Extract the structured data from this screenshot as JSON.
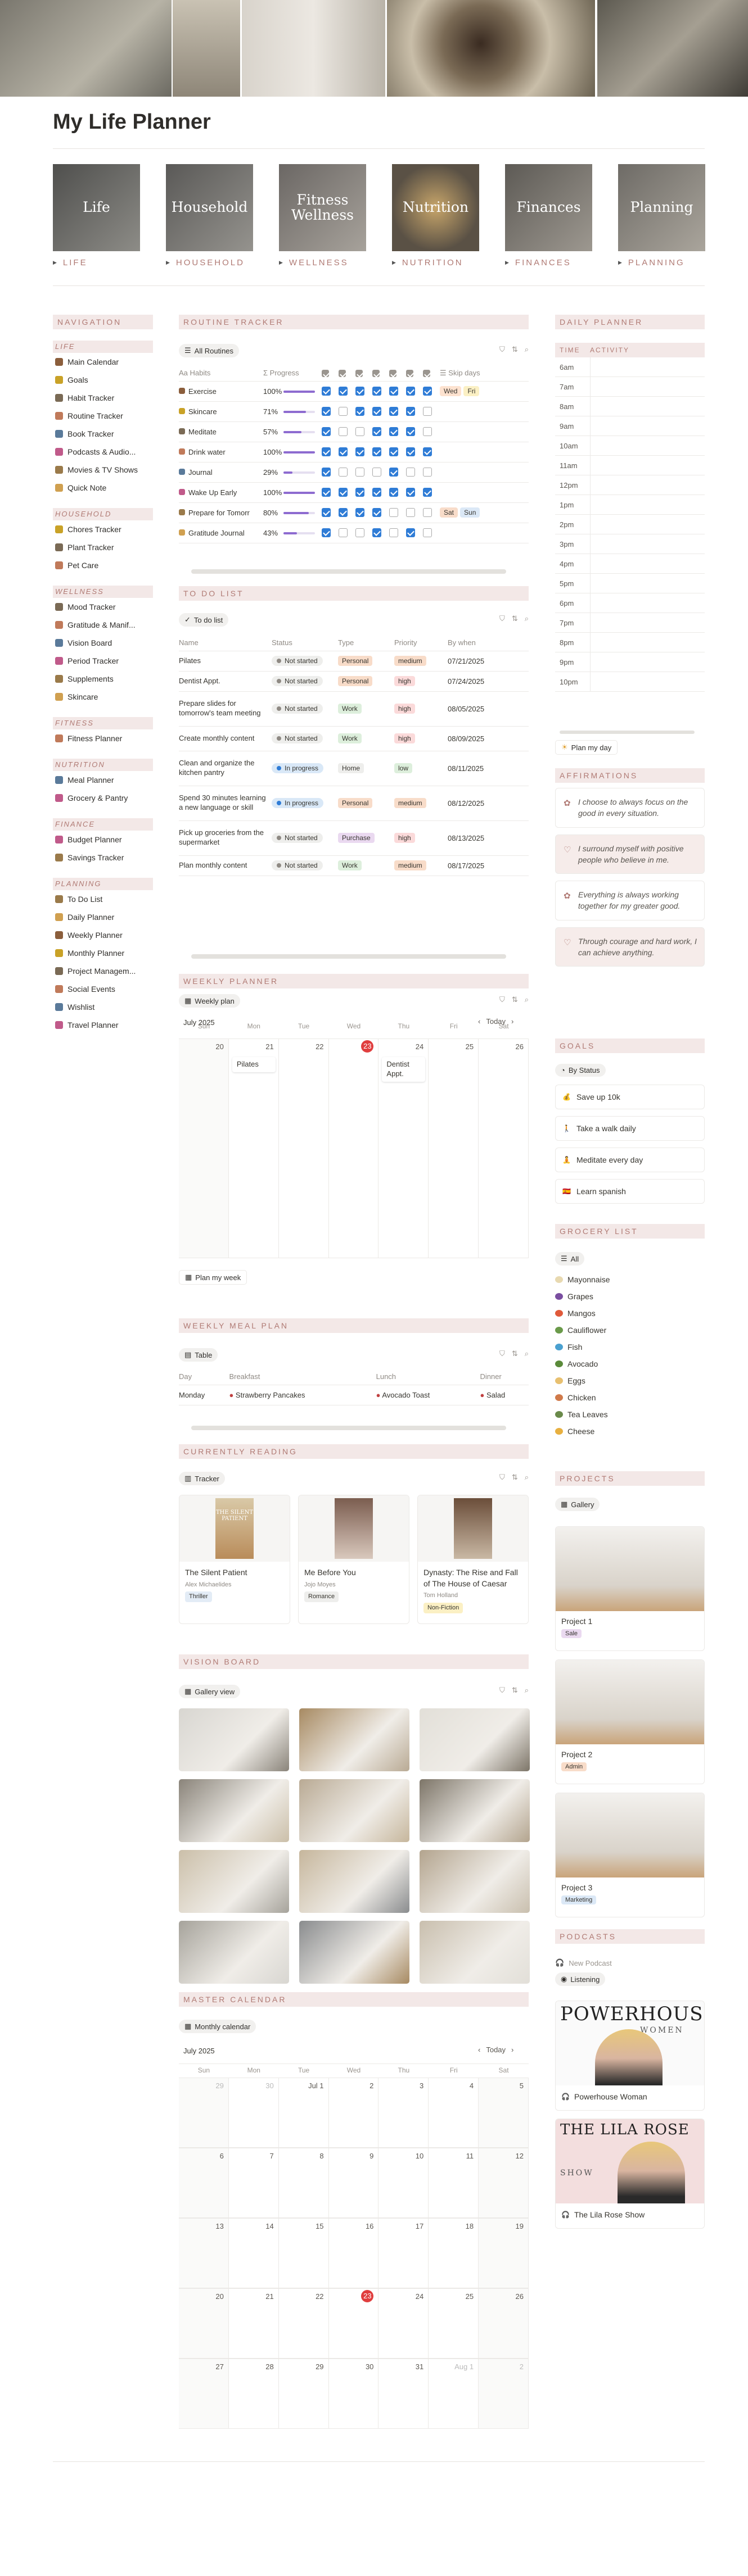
{
  "page_title": "My Life Planner",
  "categories": [
    {
      "img": "Life",
      "label": "LIFE"
    },
    {
      "img": "Household",
      "label": "HOUSEHOLD"
    },
    {
      "img": "Fitness Wellness",
      "label": "WELLNESS"
    },
    {
      "img": "Nutrition",
      "label": "NUTRITION"
    },
    {
      "img": "Finances",
      "label": "FINANCES"
    },
    {
      "img": "Planning",
      "label": "PLANNING"
    }
  ],
  "navigation": {
    "title": "NAVIGATION",
    "groups": [
      {
        "name": "LIFE",
        "items": [
          "Main Calendar",
          "Goals",
          "Habit Tracker",
          "Routine Tracker",
          "Book Tracker",
          "Podcasts & Audio...",
          "Movies & TV Shows",
          "Quick Note"
        ]
      },
      {
        "name": "HOUSEHOLD",
        "items": [
          "Chores Tracker",
          "Plant Tracker",
          "Pet Care"
        ]
      },
      {
        "name": "WELLNESS",
        "items": [
          "Mood Tracker",
          "Gratitude & Manif...",
          "Vision Board",
          "Period Tracker",
          "Supplements",
          "Skincare"
        ]
      },
      {
        "name": "FITNESS",
        "items": [
          "Fitness Planner"
        ]
      },
      {
        "name": "NUTRITION",
        "items": [
          "Meal Planner",
          "Grocery & Pantry"
        ]
      },
      {
        "name": "FINANCE",
        "items": [
          "Budget Planner",
          "Savings Tracker"
        ]
      },
      {
        "name": "PLANNING",
        "items": [
          "To Do List",
          "Daily Planner",
          "Weekly Planner",
          "Monthly Planner",
          "Project Managem...",
          "Social Events",
          "Wishlist",
          "Travel Planner"
        ]
      }
    ]
  },
  "routine": {
    "title": "ROUTINE TRACKER",
    "view": "All Routines",
    "cols": {
      "habits": "Habits",
      "progress": "Progress",
      "skip": "Skip days"
    },
    "rows": [
      {
        "name": "Exercise",
        "pct": "100%",
        "p": 1.0,
        "checks": [
          1,
          1,
          1,
          1,
          1,
          1,
          1
        ],
        "skip": [
          "Wed",
          "Fri"
        ]
      },
      {
        "name": "Skincare",
        "pct": "71%",
        "p": 0.71,
        "checks": [
          1,
          0,
          1,
          1,
          1,
          1,
          0
        ],
        "skip": []
      },
      {
        "name": "Meditate",
        "pct": "57%",
        "p": 0.57,
        "checks": [
          1,
          0,
          0,
          1,
          1,
          1,
          0
        ],
        "skip": []
      },
      {
        "name": "Drink water",
        "pct": "100%",
        "p": 1.0,
        "checks": [
          1,
          1,
          1,
          1,
          1,
          1,
          1
        ],
        "skip": []
      },
      {
        "name": "Journal",
        "pct": "29%",
        "p": 0.29,
        "checks": [
          1,
          0,
          0,
          0,
          1,
          0,
          0
        ],
        "skip": []
      },
      {
        "name": "Wake Up Early",
        "pct": "100%",
        "p": 1.0,
        "checks": [
          1,
          1,
          1,
          1,
          1,
          1,
          1
        ],
        "skip": []
      },
      {
        "name": "Prepare for Tomorr",
        "pct": "80%",
        "p": 0.8,
        "checks": [
          1,
          1,
          1,
          1,
          0,
          0,
          0
        ],
        "skip": [
          "Sat",
          "Sun"
        ]
      },
      {
        "name": "Gratitude Journal",
        "pct": "43%",
        "p": 0.43,
        "checks": [
          1,
          0,
          0,
          1,
          0,
          1,
          0
        ],
        "skip": []
      }
    ]
  },
  "todo": {
    "title": "TO DO LIST",
    "view": "To do list",
    "cols": [
      "Name",
      "Status",
      "Type",
      "Priority",
      "By when"
    ],
    "rows": [
      {
        "name": "Pilates",
        "status": "Not started",
        "type": "Personal",
        "priority": "medium",
        "date": "07/21/2025"
      },
      {
        "name": "Dentist Appt.",
        "status": "Not started",
        "type": "Personal",
        "priority": "high",
        "date": "07/24/2025"
      },
      {
        "name": "Prepare slides for tomorrow's team meeting",
        "status": "Not started",
        "type": "Work",
        "priority": "high",
        "date": "08/05/2025"
      },
      {
        "name": "Create monthly content",
        "status": "Not started",
        "type": "Work",
        "priority": "high",
        "date": "08/09/2025"
      },
      {
        "name": "Clean and organize the kitchen pantry",
        "status": "In progress",
        "type": "Home",
        "priority": "low",
        "date": "08/11/2025"
      },
      {
        "name": "Spend 30 minutes learning a new language or skill",
        "status": "In progress",
        "type": "Personal",
        "priority": "medium",
        "date": "08/12/2025"
      },
      {
        "name": "Pick up groceries from the supermarket",
        "status": "Not started",
        "type": "Purchase",
        "priority": "high",
        "date": "08/13/2025"
      },
      {
        "name": "Plan monthly content",
        "status": "Not started",
        "type": "Work",
        "priority": "medium",
        "date": "08/17/2025"
      }
    ]
  },
  "weekly": {
    "title": "WEEKLY PLANNER",
    "view": "Weekly plan",
    "month": "July 2025",
    "today": "Today",
    "days": [
      "Sun",
      "Mon",
      "Tue",
      "Wed",
      "Thu",
      "Fri",
      "Sat"
    ],
    "dates": [
      "20",
      "21",
      "22",
      "23",
      "24",
      "25",
      "26"
    ],
    "events": [
      {
        "day": 1,
        "text": "Pilates"
      },
      {
        "day": 4,
        "text": "Dentist Appt."
      }
    ],
    "button": "Plan my week"
  },
  "meal": {
    "title": "WEEKLY MEAL PLAN",
    "view": "Table",
    "cols": [
      "Day",
      "Breakfast",
      "Lunch",
      "Dinner"
    ],
    "row": [
      "Monday",
      "Strawberry Pancakes",
      "Avocado Toast",
      "Salad"
    ]
  },
  "reading": {
    "title": "CURRENTLY READING",
    "view": "Tracker",
    "books": [
      {
        "title": "The Silent Patient",
        "author": "Alex Michaelides",
        "genre": "Thriller",
        "cover": "THE SILENT PATIENT"
      },
      {
        "title": "Me Before You",
        "author": "Jojo Moyes",
        "genre": "Romance",
        "cover": ""
      },
      {
        "title": "Dynasty: The Rise and Fall of The House of Caesar",
        "author": "Tom Holland",
        "genre": "Non-Fiction",
        "cover": ""
      }
    ]
  },
  "vision": {
    "title": "VISION BOARD",
    "view": "Gallery view"
  },
  "master": {
    "title": "MASTER CALENDAR",
    "view": "Monthly calendar",
    "month": "July 2025",
    "today": "Today",
    "days": [
      "Sun",
      "Mon",
      "Tue",
      "Wed",
      "Thu",
      "Fri",
      "Sat"
    ],
    "weeks": [
      [
        "29",
        "30",
        "Jul 1",
        "2",
        "3",
        "4",
        "5"
      ],
      [
        "6",
        "7",
        "8",
        "9",
        "10",
        "11",
        "12"
      ],
      [
        "13",
        "14",
        "15",
        "16",
        "17",
        "18",
        "19"
      ],
      [
        "20",
        "21",
        "22",
        "23",
        "24",
        "25",
        "26"
      ],
      [
        "27",
        "28",
        "29",
        "30",
        "31",
        "Aug 1",
        "2"
      ]
    ]
  },
  "daily": {
    "title": "DAILY PLANNER",
    "cols": [
      "TIME",
      "ACTIVITY"
    ],
    "times": [
      "6am",
      "7am",
      "8am",
      "9am",
      "10am",
      "11am",
      "12pm",
      "1pm",
      "2pm",
      "3pm",
      "4pm",
      "5pm",
      "6pm",
      "7pm",
      "8pm",
      "9pm",
      "10pm"
    ],
    "button": "Plan my day"
  },
  "affirmations": {
    "title": "AFFIRMATIONS",
    "items": [
      "I choose to always focus on the good in every situation.",
      "I surround myself with positive people who believe in me.",
      "Everything is always working together for my greater good.",
      "Through courage and hard work, I can achieve anything."
    ]
  },
  "goals": {
    "title": "GOALS",
    "view": "By Status",
    "items": [
      "Save up 10k",
      "Take a walk daily",
      "Meditate every day",
      "Learn spanish"
    ]
  },
  "grocery": {
    "title": "GROCERY LIST",
    "view": "All",
    "items": [
      "Mayonnaise",
      "Grapes",
      "Mangos",
      "Cauliflower",
      "Fish",
      "Avocado",
      "Eggs",
      "Chicken",
      "Tea Leaves",
      "Cheese"
    ]
  },
  "projects": {
    "title": "PROJECTS",
    "view": "Gallery",
    "items": [
      {
        "name": "Project 1",
        "tag": "Sale"
      },
      {
        "name": "Project 2",
        "tag": "Admin"
      },
      {
        "name": "Project 3",
        "tag": "Marketing"
      }
    ]
  },
  "podcasts": {
    "title": "PODCASTS",
    "new": "New Podcast",
    "view": "Listening",
    "items": [
      {
        "name": "Powerhouse Woman",
        "cover": "POWERHOUSE",
        "cover2": "WOMEN"
      },
      {
        "name": "The Lila Rose Show",
        "cover": "THE LILA ROSE",
        "cover2": "SHOW"
      }
    ]
  },
  "colors": {
    "accent": "#b07a74",
    "pink": "#f3e8e7",
    "blue": "#2f7cd6",
    "today": "#e03e3e"
  }
}
